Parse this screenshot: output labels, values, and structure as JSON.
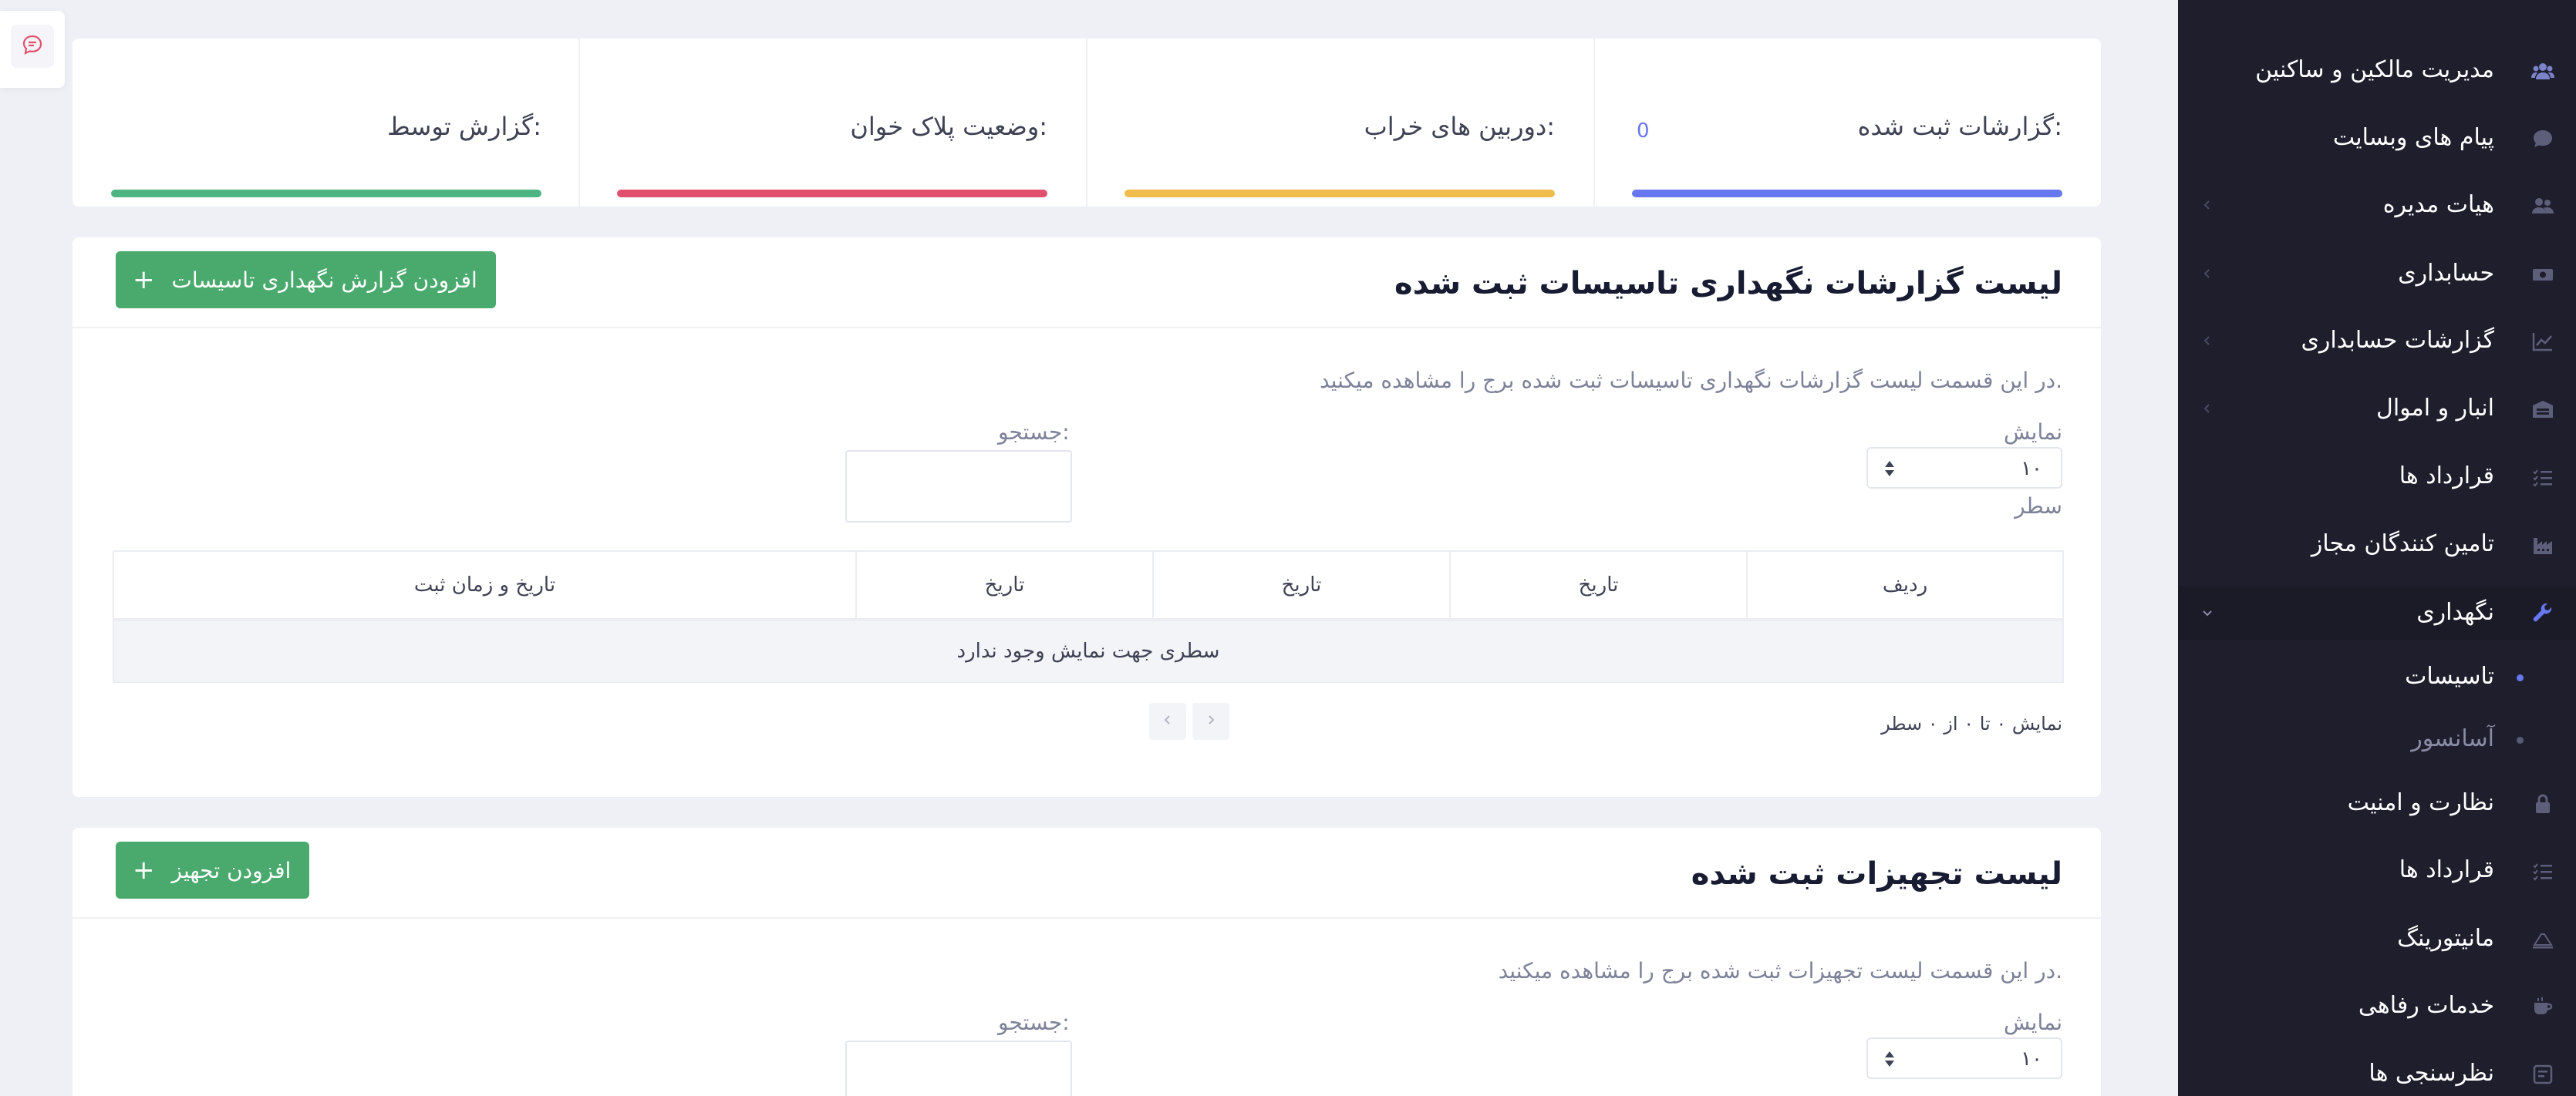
{
  "sidebar": {
    "items": [
      {
        "label": "مدیریت مالکین و ساکنین",
        "icon": "users-icon",
        "chevron": false
      },
      {
        "label": "پیام های وبسایت",
        "icon": "chat-bubble-icon",
        "chevron": false
      },
      {
        "label": "هیات مدیره",
        "icon": "user-group-icon",
        "chevron": true
      },
      {
        "label": "حسابداری",
        "icon": "money-icon",
        "chevron": true
      },
      {
        "label": "گزارشات حسابداری",
        "icon": "chart-line-icon",
        "chevron": true
      },
      {
        "label": "انبار و اموال",
        "icon": "warehouse-icon",
        "chevron": true
      },
      {
        "label": "قرارداد ها",
        "icon": "list-check-icon",
        "chevron": false
      },
      {
        "label": "تامین کنندگان مجاز",
        "icon": "industry-icon",
        "chevron": false
      },
      {
        "label": "نگهداری",
        "icon": "wrench-icon",
        "chevron": true,
        "active": true
      },
      {
        "label": "نظارت و امنیت",
        "icon": "lock-icon",
        "chevron": false
      },
      {
        "label": "قرارداد ها",
        "icon": "list-check-icon",
        "chevron": false
      },
      {
        "label": "مانیتورینگ",
        "icon": "monitor-icon",
        "chevron": false
      },
      {
        "label": "خدمات رفاهی",
        "icon": "coffee-icon",
        "chevron": false
      },
      {
        "label": "نظرسنجی ها",
        "icon": "poll-icon",
        "chevron": false
      }
    ],
    "sub_items": [
      {
        "label": "تاسیسات",
        "active": true
      },
      {
        "label": "آسانسور",
        "active": false
      }
    ]
  },
  "stats": [
    {
      "label": "گزارشات ثبت شده:",
      "value": "0",
      "color": "#6777ef"
    },
    {
      "label": "دوربین های خراب:",
      "value": "",
      "color": "#f0bc4b"
    },
    {
      "label": "وضعیت پلاک خوان:",
      "value": "",
      "color": "#e2506e"
    },
    {
      "label": "گزارش توسط:",
      "value": "",
      "color": "#4cb582"
    }
  ],
  "reports_section": {
    "title": "لیست گزارشات نگهداری تاسیسات ثبت شده",
    "add_button": "افزودن گزارش نگهداری تاسیسات",
    "description": "در این قسمت لیست گزارشات نگهداری تاسیسات ثبت شده برج را مشاهده میکنید.",
    "show_label": "نمایش",
    "page_size": "۱۰",
    "rows_label": "سطر",
    "search_label": "جستجو:",
    "columns": [
      "ردیف",
      "تاریخ",
      "تاریخ",
      "تاریخ",
      "تاریخ و زمان ثبت"
    ],
    "empty_text": "سطری جهت نمایش وجود ندارد",
    "pagination_info": "نمایش ۰ تا ۰ از ۰ سطر"
  },
  "equipment_section": {
    "title": "لیست تجهیزات ثبت شده",
    "add_button": "افزودن تجهیز",
    "description": "در این قسمت لیست تجهیزات ثبت شده برج را مشاهده میکنید.",
    "show_label": "نمایش",
    "page_size": "۱۰",
    "search_label": "جستجو:"
  },
  "colors": {
    "sidebar_bg": "#1e1e2d",
    "accent": "#6777ef",
    "success": "#4aa96c"
  }
}
